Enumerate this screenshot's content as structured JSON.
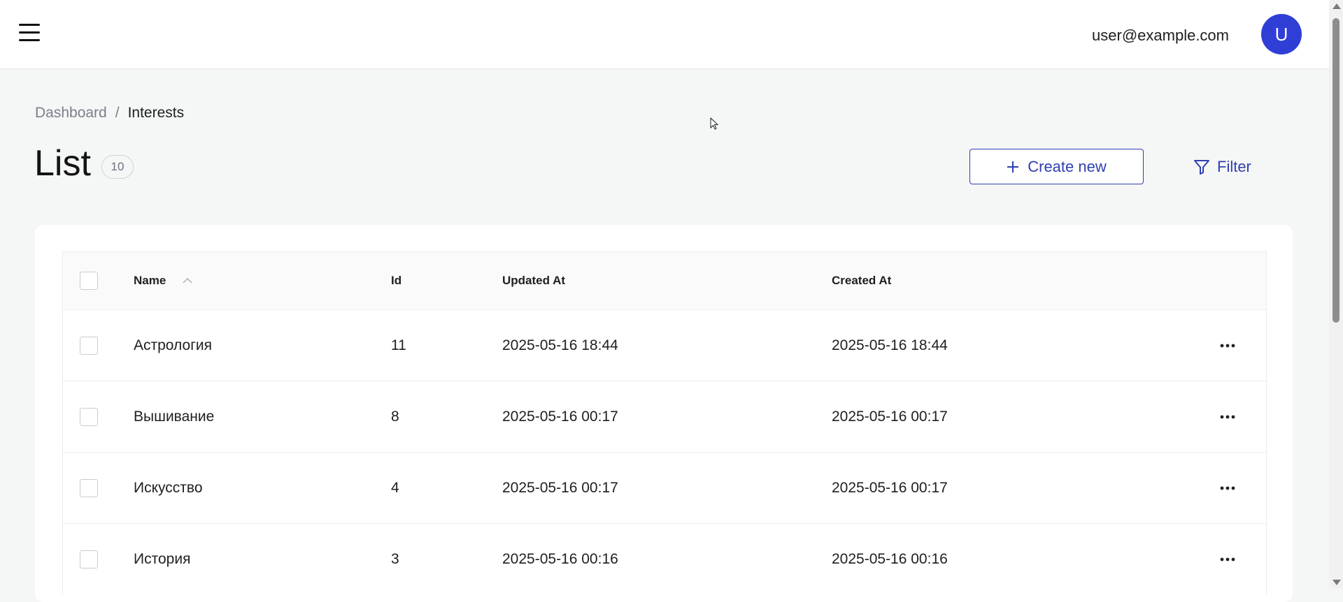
{
  "header": {
    "user_email": "user@example.com",
    "avatar_initial": "U"
  },
  "breadcrumb": {
    "parent": "Dashboard",
    "separator": "/",
    "current": "Interests"
  },
  "page": {
    "title": "List",
    "count": "10"
  },
  "actions": {
    "create_label": "Create new",
    "filter_label": "Filter"
  },
  "table": {
    "columns": {
      "name": "Name",
      "id": "Id",
      "updated_at": "Updated At",
      "created_at": "Created At"
    },
    "sort": {
      "column": "name",
      "direction": "ascending"
    },
    "rows": [
      {
        "name": "Астрология",
        "id": "11",
        "updated_at": "2025-05-16 18:44",
        "created_at": "2025-05-16 18:44"
      },
      {
        "name": "Вышивание",
        "id": "8",
        "updated_at": "2025-05-16 00:17",
        "created_at": "2025-05-16 00:17"
      },
      {
        "name": "Искусство",
        "id": "4",
        "updated_at": "2025-05-16 00:17",
        "created_at": "2025-05-16 00:17"
      },
      {
        "name": "История",
        "id": "3",
        "updated_at": "2025-05-16 00:16",
        "created_at": "2025-05-16 00:16"
      }
    ]
  },
  "colors": {
    "accent": "#2f3fb0",
    "avatar_bg": "#2f3fd6",
    "page_bg": "#f5f6f6"
  },
  "icons": {
    "menu": "hamburger-icon",
    "create": "plus-icon",
    "filter": "filter-funnel-icon",
    "sort": "chevron-up-icon",
    "row_actions": "more-horizontal-icon"
  }
}
